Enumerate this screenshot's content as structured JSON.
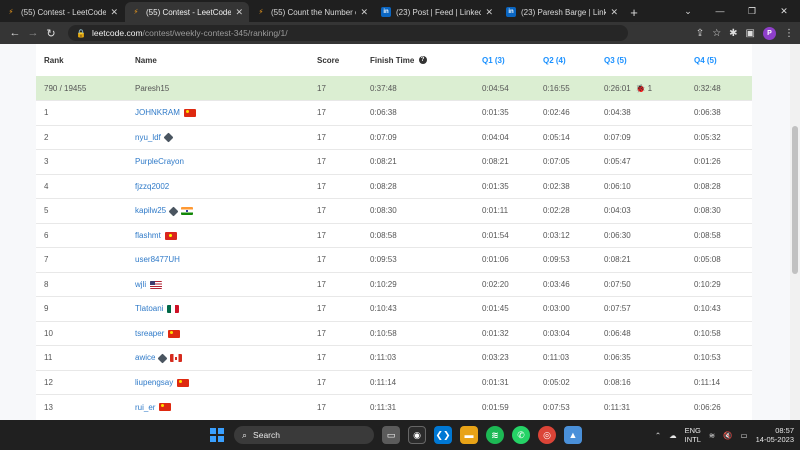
{
  "browser": {
    "tabs": [
      {
        "label": "(55) Contest - LeetCode",
        "icon": "leetcode-icon",
        "active": false
      },
      {
        "label": "(55) Contest - LeetCode",
        "icon": "leetcode-icon",
        "active": true
      },
      {
        "label": "(55) Count the Number o",
        "icon": "leetcode-icon",
        "active": false
      },
      {
        "label": "(23) Post | Feed | LinkedIn",
        "icon": "linkedin-icon",
        "active": false
      },
      {
        "label": "(23) Paresh Barge | Linked",
        "icon": "linkedin-icon",
        "active": false
      }
    ],
    "url_host": "leetcode.com",
    "url_path": "/contest/weekly-contest-345/ranking/1/",
    "avatar_letter": "P"
  },
  "ranking": {
    "headers": {
      "rank": "Rank",
      "name": "Name",
      "score": "Score",
      "finish": "Finish Time",
      "q1": "Q1 (3)",
      "q2": "Q2 (4)",
      "q3": "Q3 (5)",
      "q4": "Q4 (5)"
    },
    "me": {
      "rank": "790 / 19455",
      "name": "Paresh15",
      "score": "17",
      "finish": "0:37:48",
      "q1": "0:04:54",
      "q2": "0:16:55",
      "q3": "0:26:01",
      "q3_penalty": "1",
      "q4": "0:32:48"
    },
    "rows": [
      {
        "rank": "1",
        "name": "JOHNKRAM",
        "score": "17",
        "finish": "0:06:38",
        "q1": "0:01:35",
        "q2": "0:02:46",
        "q3": "0:04:38",
        "q4": "0:06:38"
      },
      {
        "rank": "2",
        "name": "nyu_ldf",
        "score": "17",
        "finish": "0:07:09",
        "q1": "0:04:04",
        "q2": "0:05:14",
        "q3": "0:07:09",
        "q4": "0:05:32"
      },
      {
        "rank": "3",
        "name": "PurpleCrayon",
        "score": "17",
        "finish": "0:08:21",
        "q1": "0:08:21",
        "q2": "0:07:05",
        "q3": "0:05:47",
        "q4": "0:01:26"
      },
      {
        "rank": "4",
        "name": "fjzzq2002",
        "score": "17",
        "finish": "0:08:28",
        "q1": "0:01:35",
        "q2": "0:02:38",
        "q3": "0:06:10",
        "q4": "0:08:28"
      },
      {
        "rank": "5",
        "name": "kapilw25",
        "score": "17",
        "finish": "0:08:30",
        "q1": "0:01:11",
        "q2": "0:02:28",
        "q3": "0:04:03",
        "q4": "0:08:30"
      },
      {
        "rank": "6",
        "name": "flashmt",
        "score": "17",
        "finish": "0:08:58",
        "q1": "0:01:54",
        "q2": "0:03:12",
        "q3": "0:06:30",
        "q4": "0:08:58"
      },
      {
        "rank": "7",
        "name": "user8477UH",
        "score": "17",
        "finish": "0:09:53",
        "q1": "0:01:06",
        "q2": "0:09:53",
        "q3": "0:08:21",
        "q4": "0:05:08"
      },
      {
        "rank": "8",
        "name": "wjli",
        "score": "17",
        "finish": "0:10:29",
        "q1": "0:02:20",
        "q2": "0:03:46",
        "q3": "0:07:50",
        "q4": "0:10:29"
      },
      {
        "rank": "9",
        "name": "Tlatoani",
        "score": "17",
        "finish": "0:10:43",
        "q1": "0:01:45",
        "q2": "0:03:00",
        "q3": "0:07:57",
        "q4": "0:10:43"
      },
      {
        "rank": "10",
        "name": "tsreaper",
        "score": "17",
        "finish": "0:10:58",
        "q1": "0:01:32",
        "q2": "0:03:04",
        "q3": "0:06:48",
        "q4": "0:10:58"
      },
      {
        "rank": "11",
        "name": "awice",
        "score": "17",
        "finish": "0:11:03",
        "q1": "0:03:23",
        "q2": "0:11:03",
        "q3": "0:06:35",
        "q4": "0:10:53"
      },
      {
        "rank": "12",
        "name": "liupengsay",
        "score": "17",
        "finish": "0:11:14",
        "q1": "0:01:31",
        "q2": "0:05:02",
        "q3": "0:08:16",
        "q4": "0:11:14"
      },
      {
        "rank": "13",
        "name": "rui_er",
        "score": "17",
        "finish": "0:11:31",
        "q1": "0:01:59",
        "q2": "0:07:53",
        "q3": "0:11:31",
        "q4": "0:06:26"
      }
    ]
  },
  "taskbar": {
    "search_placeholder": "Search",
    "lang_line1": "ENG",
    "lang_line2": "INTL",
    "time": "08:57",
    "date": "14-05-2023"
  }
}
